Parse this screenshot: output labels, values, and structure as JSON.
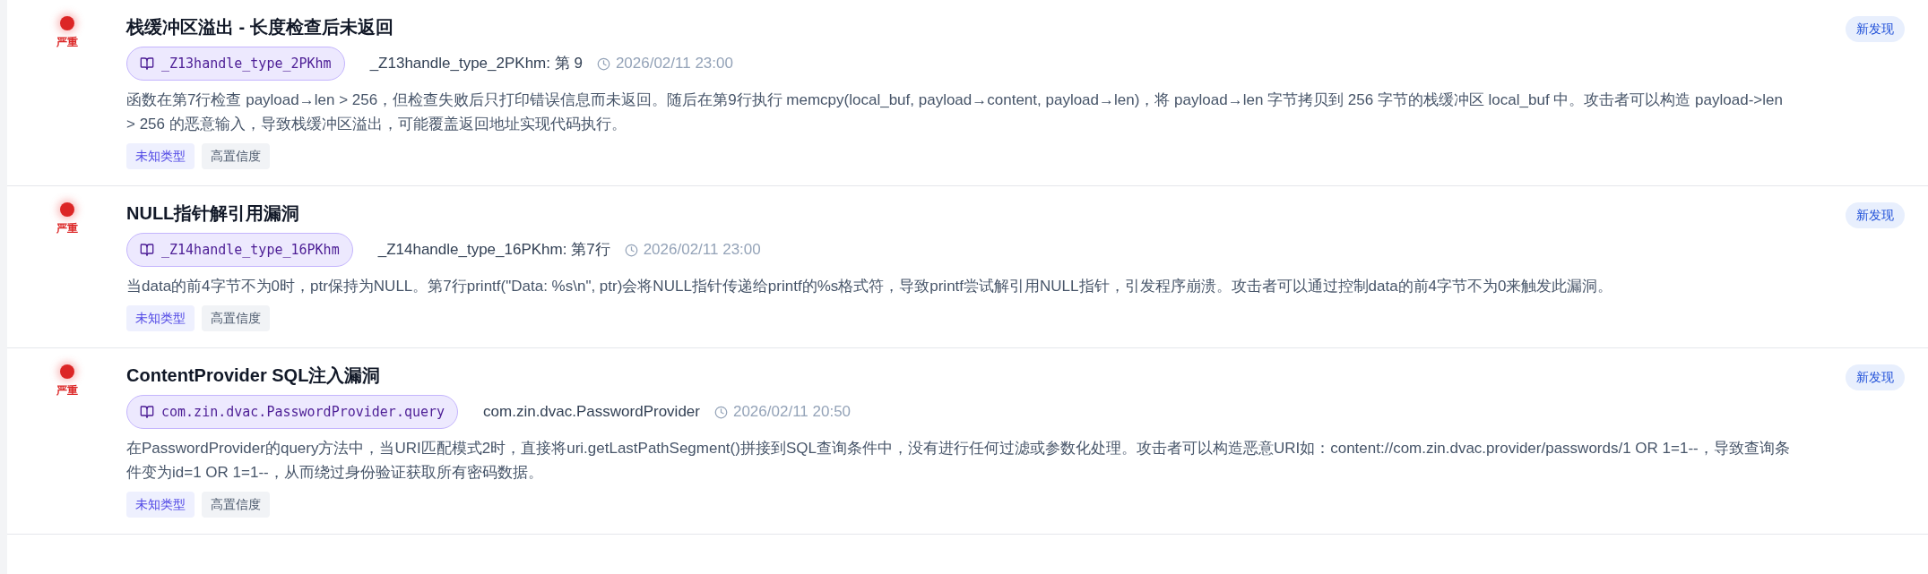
{
  "findings": [
    {
      "severity": "严重",
      "title": "栈缓冲区溢出 - 长度检查后未返回",
      "function": "_Z13handle_type_2PKhm",
      "location": "_Z13handle_type_2PKhm: 第 9",
      "time": "2026/02/11 23:00",
      "status": "新发现",
      "description": "函数在第7行检查 payload→len > 256，但检查失败后只打印错误信息而未返回。随后在第9行执行 memcpy(local_buf, payload→content, payload→len)，将 payload→len 字节拷贝到 256 字节的栈缓冲区 local_buf 中。攻击者可以构造 payload->len > 256 的恶意输入，导致栈缓冲区溢出，可能覆盖返回地址实现代码执行。",
      "tags": [
        {
          "kind": "type",
          "label": "未知类型"
        },
        {
          "kind": "confidence",
          "label": "高置信度"
        }
      ]
    },
    {
      "severity": "严重",
      "title": "NULL指针解引用漏洞",
      "function": "_Z14handle_type_16PKhm",
      "location": "_Z14handle_type_16PKhm: 第7行",
      "time": "2026/02/11 23:00",
      "status": "新发现",
      "description": "当data的前4字节不为0时，ptr保持为NULL。第7行printf(\"Data: %s\\n\", ptr)会将NULL指针传递给printf的%s格式符，导致printf尝试解引用NULL指针，引发程序崩溃。攻击者可以通过控制data的前4字节不为0来触发此漏洞。",
      "tags": [
        {
          "kind": "type",
          "label": "未知类型"
        },
        {
          "kind": "confidence",
          "label": "高置信度"
        }
      ]
    },
    {
      "severity": "严重",
      "title": "ContentProvider SQL注入漏洞",
      "function": "com.zin.dvac.PasswordProvider.query",
      "location": "com.zin.dvac.PasswordProvider",
      "time": "2026/02/11 20:50",
      "status": "新发现",
      "description": "在PasswordProvider的query方法中，当URI匹配模式2时，直接将uri.getLastPathSegment()拼接到SQL查询条件中，没有进行任何过滤或参数化处理。攻击者可以构造恶意URI如：content://com.zin.dvac.provider/passwords/1 OR 1=1--，导致查询条件变为id=1 OR 1=1--，从而绕过身份验证获取所有密码数据。",
      "tags": [
        {
          "kind": "type",
          "label": "未知类型"
        },
        {
          "kind": "confidence",
          "label": "高置信度"
        }
      ]
    }
  ]
}
